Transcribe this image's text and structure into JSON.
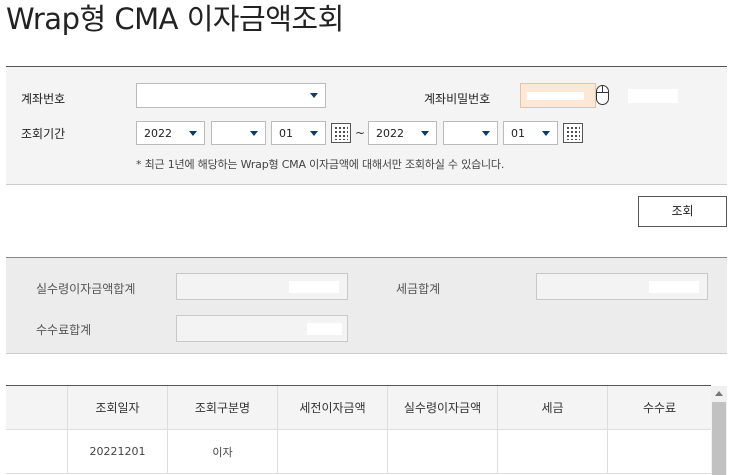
{
  "title": "Wrap형 CMA 이자금액조회",
  "form": {
    "account_label": "계좌번호",
    "account_value": "",
    "password_label": "계좌비밀번호",
    "period_label": "조회기간",
    "from": {
      "year": "2022",
      "month": "",
      "day": "01"
    },
    "to": {
      "year": "2022",
      "month": "",
      "day": "01"
    },
    "tilde": "~",
    "note": "* 최근 1년에 해당하는 Wrap형 CMA 이자금액에 대해서만 조회하실 수 있습니다."
  },
  "search_button": "조회",
  "summary": {
    "net_interest_label": "실수령이자금액합계",
    "tax_label": "세금합계",
    "fee_label": "수수료합계"
  },
  "table": {
    "headers": [
      "",
      "조회일자",
      "조회구분명",
      "세전이자금액",
      "실수령이자금액",
      "세금",
      "수수료"
    ],
    "rows": [
      [
        "",
        "20221201",
        "이자",
        "",
        "",
        "",
        ""
      ]
    ]
  },
  "icons": {
    "calendar": "calendar-icon",
    "mouse": "mouse-icon",
    "dropdown": "chevron-down-icon"
  }
}
